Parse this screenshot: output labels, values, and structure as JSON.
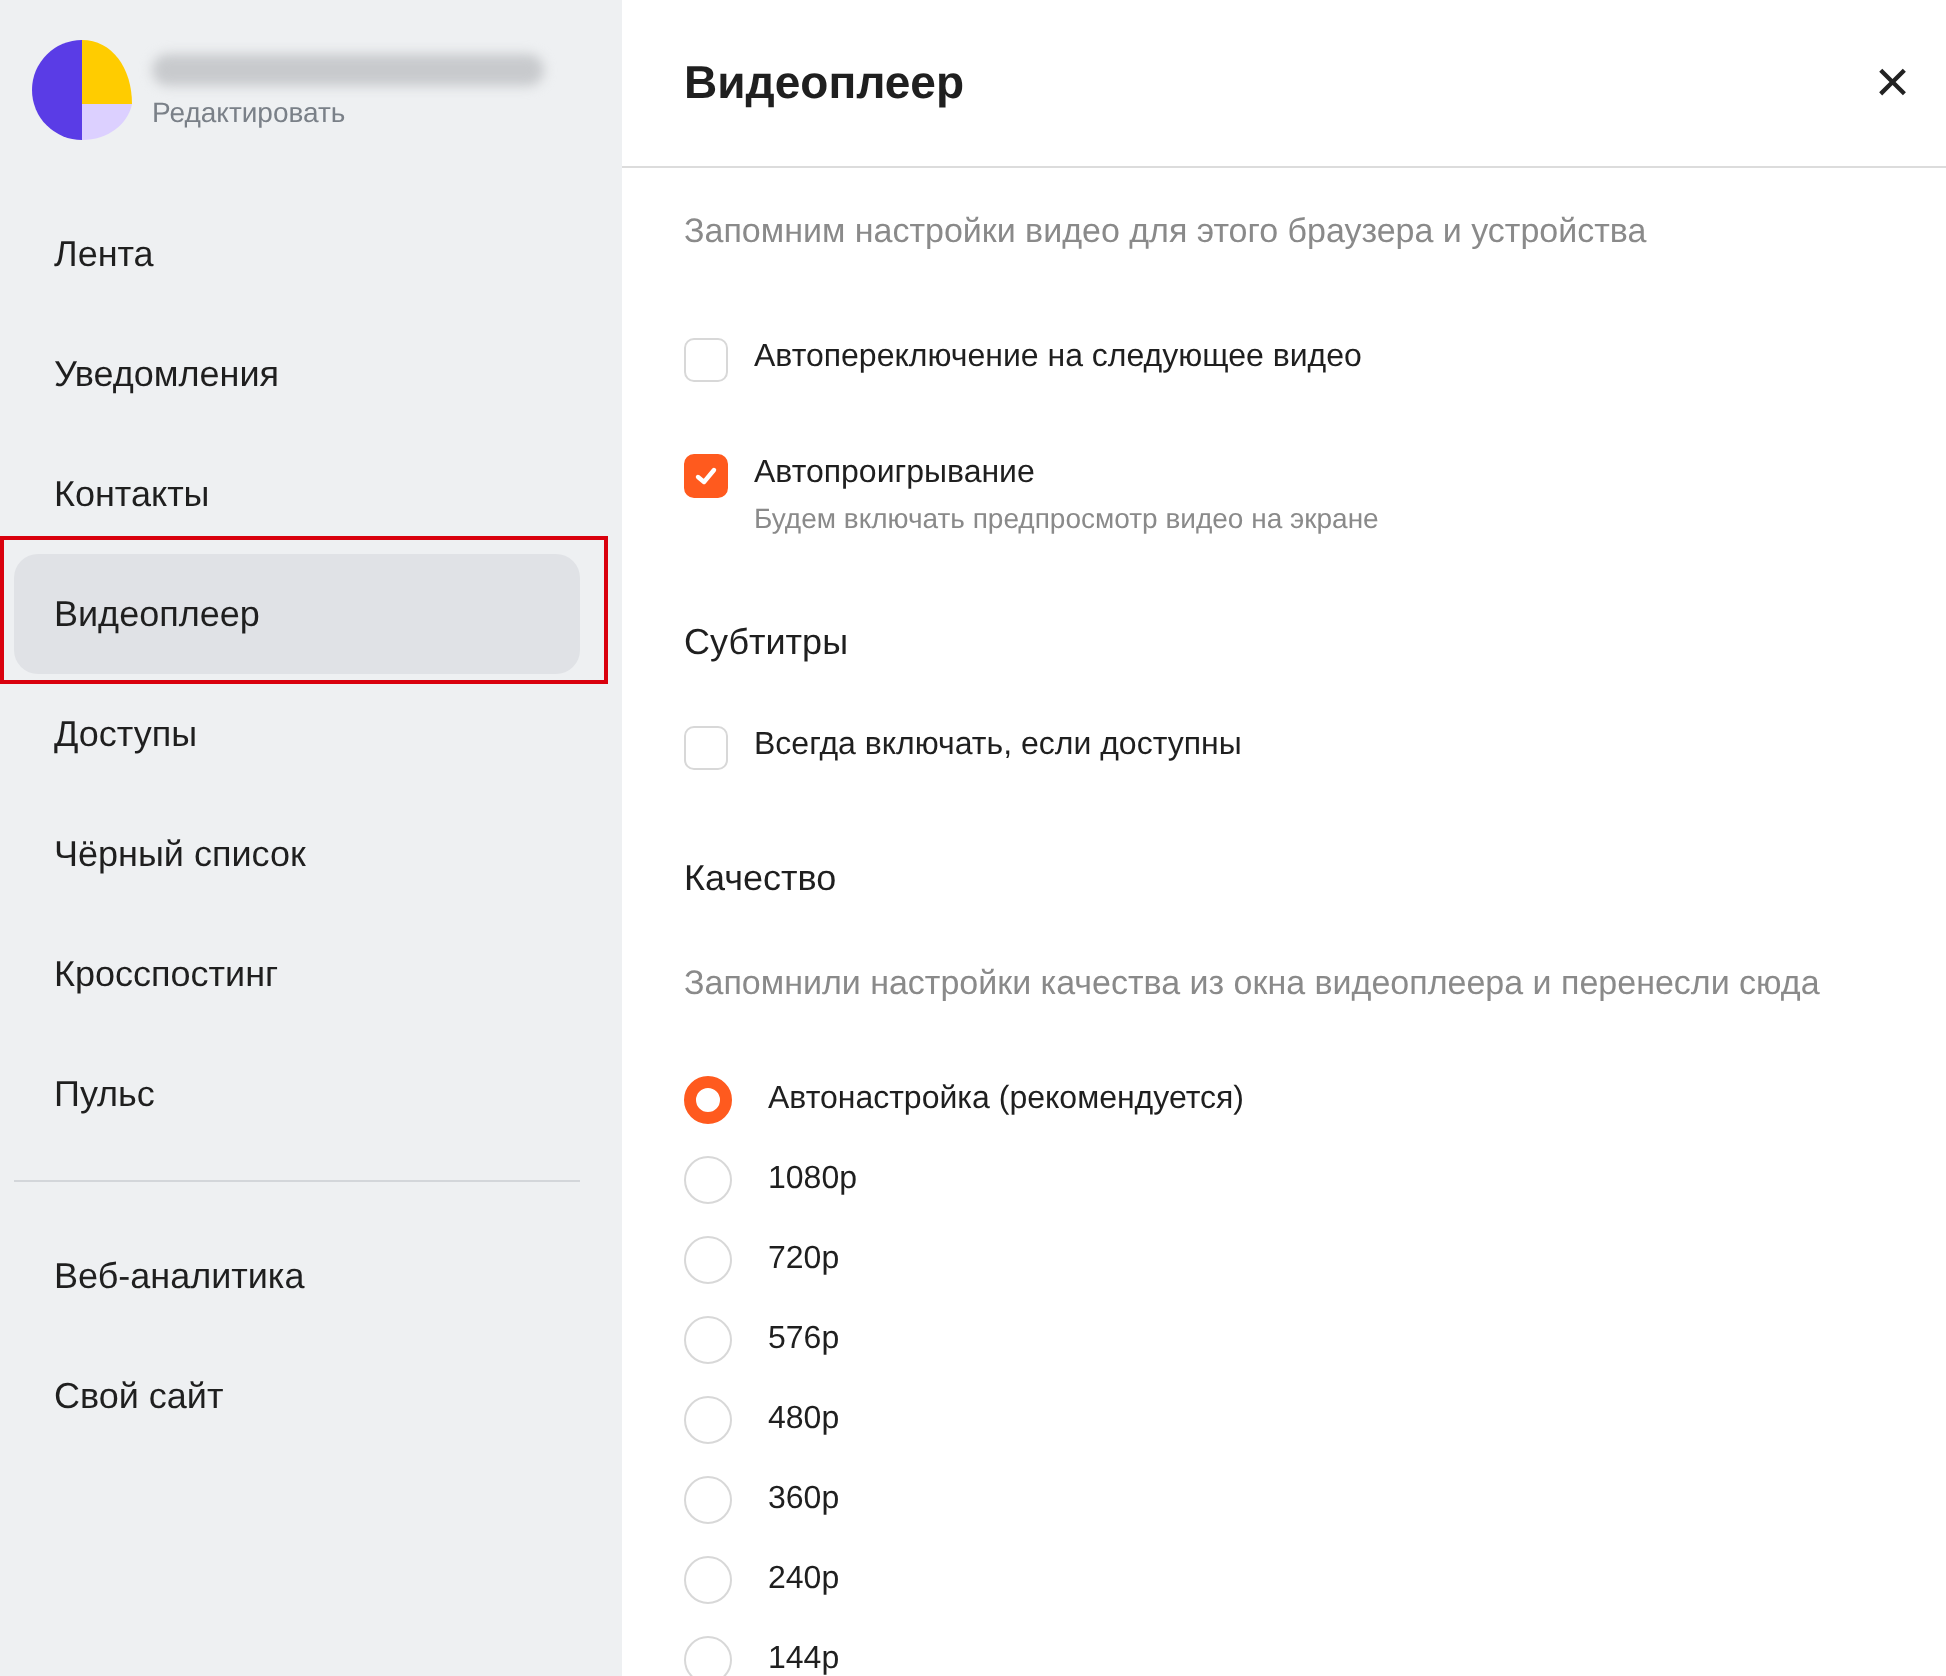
{
  "profile": {
    "edit_link": "Редактировать"
  },
  "sidebar": {
    "items": [
      {
        "label": "Лента",
        "selected": false,
        "highlighted": false
      },
      {
        "label": "Уведомления",
        "selected": false,
        "highlighted": false
      },
      {
        "label": "Контакты",
        "selected": false,
        "highlighted": false
      },
      {
        "label": "Видеоплеер",
        "selected": true,
        "highlighted": true
      },
      {
        "label": "Доступы",
        "selected": false,
        "highlighted": false
      },
      {
        "label": "Чёрный список",
        "selected": false,
        "highlighted": false
      },
      {
        "label": "Кросспостинг",
        "selected": false,
        "highlighted": false
      },
      {
        "label": "Пульс",
        "selected": false,
        "highlighted": false
      }
    ],
    "extra_items": [
      {
        "label": "Веб-аналитика",
        "selected": false
      },
      {
        "label": "Свой сайт",
        "selected": false
      }
    ]
  },
  "panel": {
    "title": "Видеоплеер",
    "close": "×"
  },
  "sections": [
    {
      "kind": "checks",
      "hint": "Запомним настройки видео для этого браузера и устройства",
      "options": [
        {
          "label": "Автопереключение на следующее видео",
          "checked": false
        },
        {
          "label": "Автопроигрывание",
          "checked": true,
          "hint": "Будем включать предпросмотр видео на экране"
        }
      ]
    },
    {
      "kind": "checks",
      "heading": "Субтитры",
      "options": [
        {
          "label": "Всегда включать, если доступны",
          "checked": false
        }
      ]
    },
    {
      "kind": "radios",
      "heading": "Качество",
      "hint": "Запомнили настройки качества из окна видеоплеера и перенесли сюда",
      "options": [
        {
          "label": "Автонастройка (рекомендуется)",
          "selected": true
        },
        {
          "label": "1080p",
          "selected": false
        },
        {
          "label": "720p",
          "selected": false
        },
        {
          "label": "576p",
          "selected": false
        },
        {
          "label": "480p",
          "selected": false
        },
        {
          "label": "360p",
          "selected": false
        },
        {
          "label": "240p",
          "selected": false
        },
        {
          "label": "144p",
          "selected": false
        }
      ]
    }
  ]
}
